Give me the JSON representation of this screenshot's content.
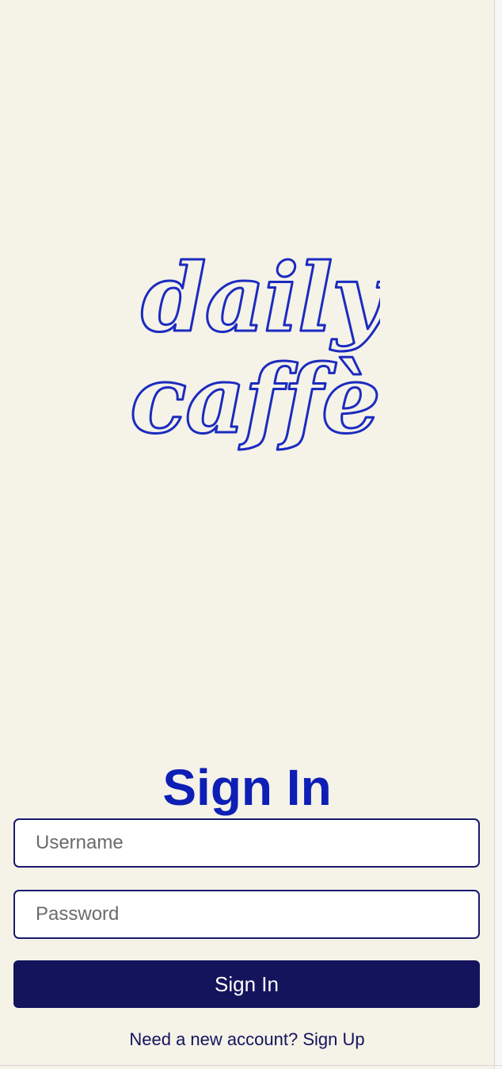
{
  "logo": {
    "line1": "daily",
    "line2": "caffè"
  },
  "heading": "Sign In",
  "form": {
    "username_placeholder": "Username",
    "password_placeholder": "Password",
    "submit_label": "Sign In"
  },
  "footer": {
    "prompt": "Need a new account?",
    "link": "Sign Up"
  },
  "colors": {
    "background": "#f5f2e8",
    "logo_outline": "#1b2bbf",
    "heading": "#0d1fb5",
    "button": "#14145c",
    "field_border": "#1a1a6e"
  }
}
